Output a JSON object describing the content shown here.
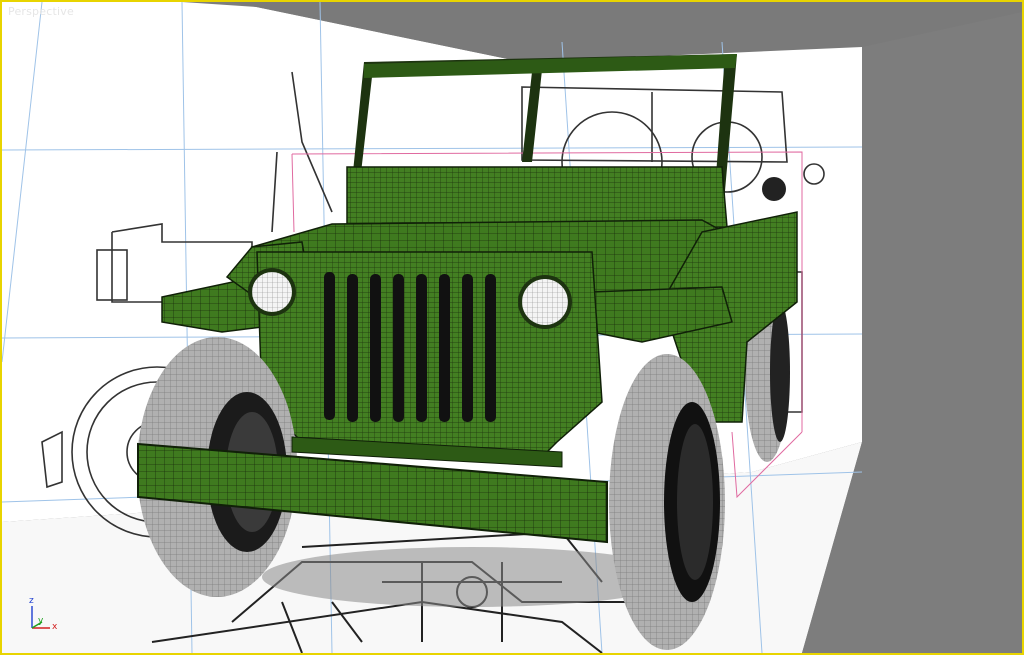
{
  "viewport": {
    "label": "Perspective",
    "active_border_color": "#e8d400",
    "background_color": "#7d7d7d"
  },
  "scene": {
    "model": "jeep",
    "model_color": "#3f7a1f",
    "wire_color": "#1a2e0d",
    "tire_color": "#9a9a9a",
    "blueprint_panel_color": "#ffffff",
    "grid_line_color": "#9fc3e8",
    "selection_box_color": "#e06aa0"
  },
  "gizmo": {
    "x": "x",
    "y": "y",
    "z": "z",
    "x_color": "#d22020",
    "y_color": "#20a020",
    "z_color": "#2040d0"
  }
}
